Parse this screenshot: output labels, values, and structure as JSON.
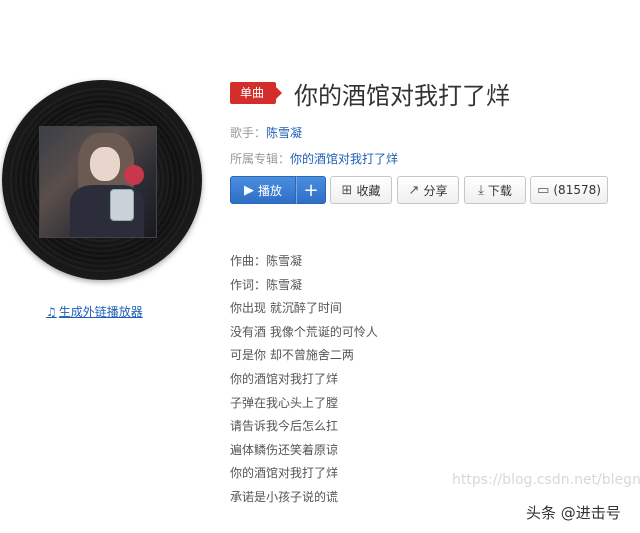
{
  "tag": "单曲",
  "title": "你的酒馆对我打了烊",
  "singer": {
    "label": "歌手：",
    "name": "陈雪凝"
  },
  "album": {
    "label": "所属专辑：",
    "name": "你的酒馆对我打了烊"
  },
  "buttons": {
    "play": "播放",
    "add": "+",
    "collect": "收藏",
    "share": "分享",
    "download": "下载",
    "comments": "(81578)"
  },
  "icons": {
    "play": "play-circle-icon",
    "collect": "folder-add-icon",
    "share": "share-icon",
    "download": "download-icon",
    "comment": "comment-icon",
    "music": "music-note-icon"
  },
  "player_link": "生成外链播放器",
  "lyrics": [
    "作曲：陈雪凝",
    "作词：陈雪凝",
    "你出现 就沉醉了时间",
    "没有酒 我像个荒诞的可怜人",
    "可是你 却不曾施舍二两",
    "你的酒馆对我打了烊",
    "子弹在我心头上了膛",
    "请告诉我今后怎么扛",
    "遍体鳞伤还笑着原谅",
    "你的酒馆对我打了烊",
    "承诺是小孩子说的谎"
  ],
  "watermark": "https://blog.csdn.net/blegn",
  "brand": "头条 @进击号",
  "colors": {
    "tag": "#d32e2b",
    "link": "#1e5fb4",
    "play_button": "#2e6fc6"
  }
}
